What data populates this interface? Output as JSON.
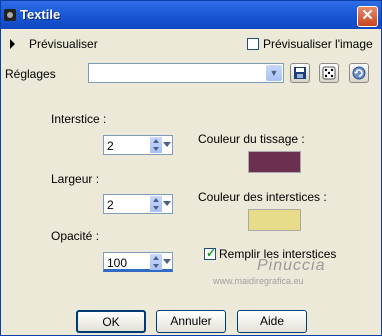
{
  "window": {
    "title": "Textile"
  },
  "preview": {
    "toggle_label": "Prévisualiser",
    "image_checkbox_label": "Prévisualiser l'image",
    "image_checked": false
  },
  "settings": {
    "label": "Réglages",
    "preset_value": ""
  },
  "fields": {
    "interstice": {
      "label": "Interstice :",
      "value": "2"
    },
    "largeur": {
      "label": "Largeur :",
      "value": "2"
    },
    "opacite": {
      "label": "Opacité :",
      "value": "100"
    }
  },
  "colors": {
    "tissage": {
      "label": "Couleur du tissage :",
      "hex": "#6b2f4f"
    },
    "interstices": {
      "label": "Couleur des interstices :",
      "hex": "#e6dc8a"
    }
  },
  "fill_interstices": {
    "label": "Remplir les interstices",
    "checked": true
  },
  "watermark": {
    "name": "Pinuccia",
    "url": "www.maidiregrafica.eu"
  },
  "buttons": {
    "ok": "OK",
    "cancel": "Annuler",
    "help": "Aide"
  }
}
